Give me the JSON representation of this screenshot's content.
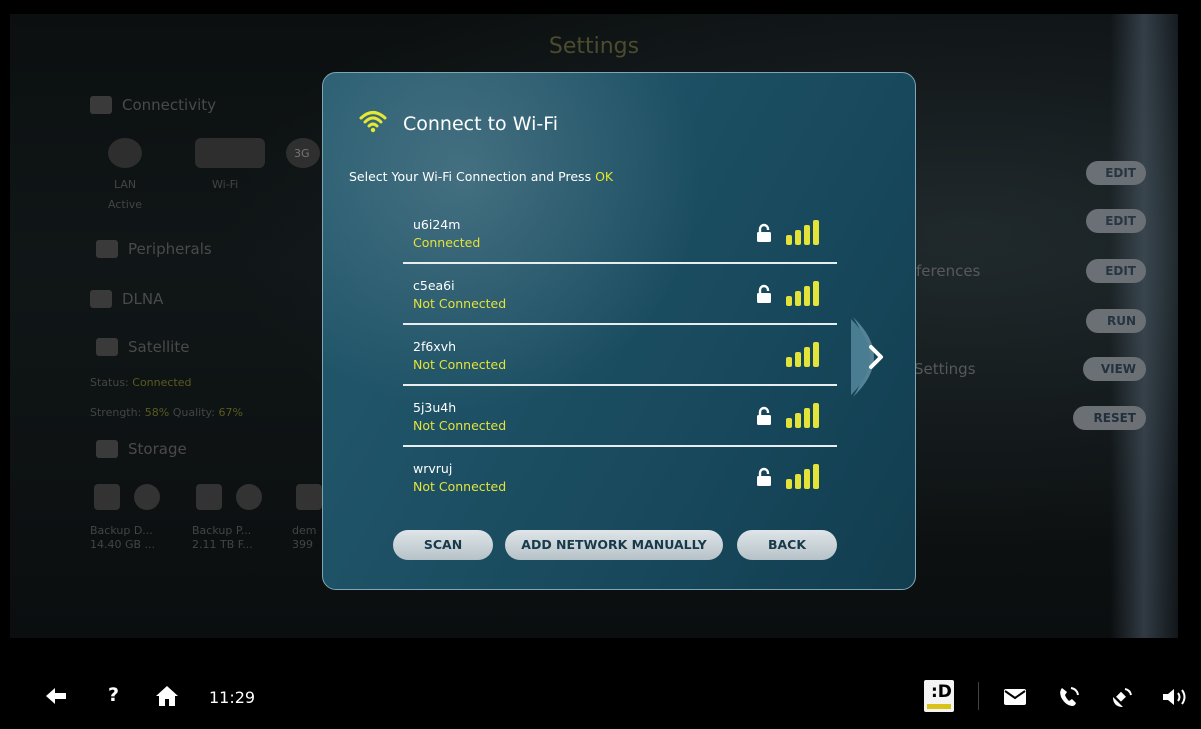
{
  "background": {
    "title": "Settings",
    "sections": {
      "connectivity": "Connectivity",
      "lan_label": "LAN",
      "lan_status": "Active",
      "wifi_label": "Wi-Fi",
      "badge_3g": "3G",
      "peripherals": "Peripherals",
      "dlna": "DLNA",
      "satellite": "Satellite",
      "status_label": "Status:",
      "status_value": "Connected",
      "strength_label": "Strength:",
      "strength_value": "58%",
      "quality_label": "Quality:",
      "quality_value": "67%",
      "storage": "Storage"
    },
    "storage_items": [
      {
        "name": "Backup D...",
        "size": "14.40 GB ..."
      },
      {
        "name": "Backup P...",
        "size": "2.11 TB F..."
      },
      {
        "name": "dem",
        "size": "399"
      }
    ],
    "right_texts": [
      "ferences",
      "Settings"
    ],
    "right_buttons": [
      "EDIT",
      "EDIT",
      "EDIT",
      "RUN",
      "VIEW",
      "RESET"
    ]
  },
  "dialog": {
    "title": "Connect to Wi-Fi",
    "instruction": "Select Your Wi-Fi Connection and Press ",
    "instruction_ok": "OK",
    "networks": [
      {
        "name": "u6i24m",
        "status": "Connected",
        "locked": true
      },
      {
        "name": "c5ea6i",
        "status": "Not Connected",
        "locked": true
      },
      {
        "name": "2f6xvh",
        "status": "Not Connected",
        "locked": false
      },
      {
        "name": "5j3u4h",
        "status": "Not Connected",
        "locked": true
      },
      {
        "name": "wrvruj",
        "status": "Not Connected",
        "locked": true
      }
    ],
    "buttons": {
      "scan": "SCAN",
      "add": "ADD NETWORK MANUALLY",
      "back": "BACK"
    }
  },
  "taskbar": {
    "time": "11:29",
    "logo_letter": ":D"
  },
  "colors": {
    "accent": "#e3e33a",
    "dialog_bg": "#1d5064"
  }
}
